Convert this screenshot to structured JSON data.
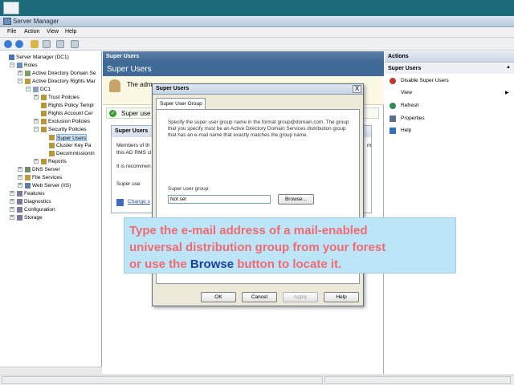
{
  "window": {
    "title": "Server Manager"
  },
  "menu": [
    "File",
    "Action",
    "View",
    "Help"
  ],
  "tree": [
    {
      "label": "Server Manager (DC1)",
      "level": 0,
      "exp": ""
    },
    {
      "label": "Roles",
      "level": 1,
      "exp": "-"
    },
    {
      "label": "Active Directory Domain Se",
      "level": 2,
      "exp": "+"
    },
    {
      "label": "Active Directory Rights Mar",
      "level": 2,
      "exp": "-"
    },
    {
      "label": "DC1",
      "level": 3,
      "exp": "-"
    },
    {
      "label": "Trust Policies",
      "level": 4,
      "exp": "+"
    },
    {
      "label": "Rights Policy Templ",
      "level": 4,
      "exp": ""
    },
    {
      "label": "Rights Account Cer",
      "level": 4,
      "exp": ""
    },
    {
      "label": "Exclusion Policies",
      "level": 4,
      "exp": "+"
    },
    {
      "label": "Security Policies",
      "level": 4,
      "exp": "-"
    },
    {
      "label": "Super Users",
      "level": 5,
      "exp": "",
      "selected": true
    },
    {
      "label": "Cluster Key Pa",
      "level": 5,
      "exp": ""
    },
    {
      "label": "Decommissionin",
      "level": 5,
      "exp": ""
    },
    {
      "label": "Reports",
      "level": 4,
      "exp": "+"
    },
    {
      "label": "DNS Server",
      "level": 2,
      "exp": "+"
    },
    {
      "label": "File Services",
      "level": 2,
      "exp": "+"
    },
    {
      "label": "Web Server (IIS)",
      "level": 2,
      "exp": "+"
    },
    {
      "label": "Features",
      "level": 1,
      "exp": "+"
    },
    {
      "label": "Diagnostics",
      "level": 1,
      "exp": "+"
    },
    {
      "label": "Configuration",
      "level": 1,
      "exp": "+"
    },
    {
      "label": "Storage",
      "level": 1,
      "exp": "+"
    }
  ],
  "center": {
    "header": "Super Users",
    "title": "Super Users",
    "banner_text": "The adm",
    "status_text": "Super use",
    "group_header": "Super Users",
    "group_line1": "Members of th",
    "group_line2": "this AD RMS cl",
    "group_line3": "It is recommen",
    "group_line4": "Super use",
    "group_link": "Change s",
    "right_frag": "m"
  },
  "actions": {
    "header": "Actions",
    "section": "Super Users",
    "items": [
      {
        "label": "Disable Super Users",
        "icon": "disable-icon",
        "color": "#c0392b"
      },
      {
        "label": "View",
        "icon": "",
        "submenu": true
      },
      {
        "label": "Refresh",
        "icon": "refresh-icon",
        "color": "#2e8b57"
      },
      {
        "label": "Properties",
        "icon": "properties-icon",
        "color": "#5a6f8c"
      },
      {
        "label": "Help",
        "icon": "help-icon",
        "color": "#2f6fc4"
      }
    ]
  },
  "dialog": {
    "title": "Super Users",
    "close": "X",
    "tab": "Super User Group",
    "description": "Specify the super user group name in the format group@domain.com. The group that you specify must be an Active Directory Domain Services distribution group that has an e-mail name that exactly matches the group name.",
    "field_label": "Super user group:",
    "field_value": "Not set",
    "browse_label": "Browse...",
    "ok_label": "OK",
    "cancel_label": "Cancel",
    "apply_label": "Apply",
    "help_label": "Help"
  },
  "callout": {
    "line1": "Type the e-mail address of a mail-enabled",
    "line2": "universal distribution group from your forest",
    "line3_pre": "or use the ",
    "line3_bold": "Browse",
    "line3_post": " button to locate it."
  },
  "colors": {
    "callout_bg": "#bde5f8",
    "callout_text": "#f06a72",
    "callout_highlight": "#1a3fa0",
    "header_blue": "#3f6a98"
  }
}
